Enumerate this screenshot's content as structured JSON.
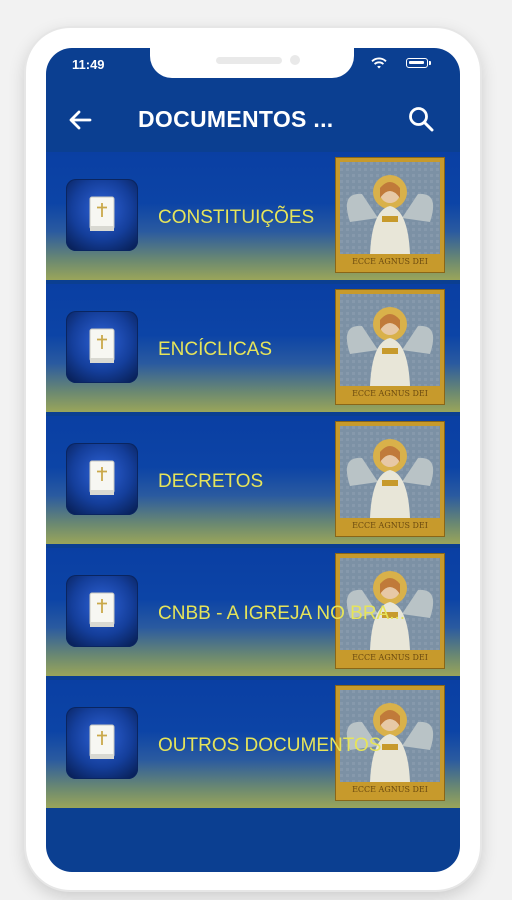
{
  "status_bar": {
    "time": "11:49",
    "icons": [
      "wifi-icon",
      "battery-icon"
    ]
  },
  "app_bar": {
    "title": "DOCUMENTOS ...",
    "back_icon": "back-arrow-icon",
    "search_icon": "search-icon"
  },
  "documents": [
    {
      "label": "CONSTITUIÇÕES",
      "icon": "book-icon",
      "image_text": "ECCE AGNUS DEI"
    },
    {
      "label": "ENCÍCLICAS",
      "icon": "book-icon",
      "image_text": "ECCE AGNUS DEI"
    },
    {
      "label": "DECRETOS",
      "icon": "book-icon",
      "image_text": "ECCE AGNUS DEI"
    },
    {
      "label": "CNBB - A IGREJA NO BRA...",
      "icon": "book-icon",
      "image_text": "ECCE AGNUS DEI"
    },
    {
      "label": "OUTROS DOCUMENTOS",
      "icon": "book-icon",
      "image_text": "ECCE AGNUS DEI"
    }
  ],
  "colors": {
    "primary": "#0b3f91",
    "label_text": "#e6e45a",
    "frame_gold": "#c79a2c"
  }
}
